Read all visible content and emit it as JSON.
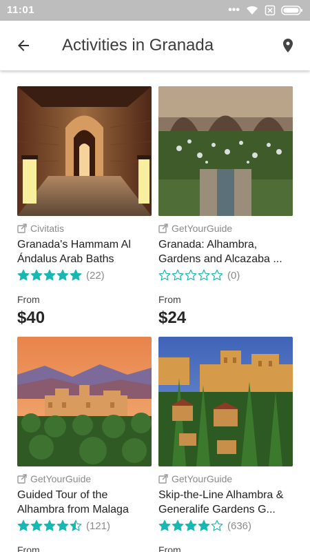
{
  "status_bar": {
    "time": "11:01",
    "icons": [
      "more-dots-icon",
      "wifi-icon",
      "no-sim-icon",
      "battery-icon"
    ]
  },
  "header": {
    "title": "Activities in Granada",
    "back_icon": "back-arrow-icon",
    "map_icon": "map-pin-icon"
  },
  "colors": {
    "star": "#17b8b2",
    "accent": "#17b8b2"
  },
  "activities": [
    {
      "provider": "Civitatis",
      "title": "Granada's Hammam Al Ándalus Arab Baths",
      "rating": 5,
      "reviews": "(22)",
      "from_label": "From",
      "price": "$40"
    },
    {
      "provider": "GetYourGuide",
      "title": "Granada: Alhambra, Gardens and Alcazaba ...",
      "rating": 0,
      "reviews": "(0)",
      "from_label": "From",
      "price": "$24"
    },
    {
      "provider": "GetYourGuide",
      "title": "Guided Tour of the Alhambra from Malaga",
      "rating": 4.5,
      "reviews": "(121)",
      "from_label": "From",
      "price": ""
    },
    {
      "provider": "GetYourGuide",
      "title": "Skip-the-Line Alhambra & Generalife Gardens G...",
      "rating": 4,
      "reviews": "(636)",
      "from_label": "From",
      "price": ""
    }
  ]
}
